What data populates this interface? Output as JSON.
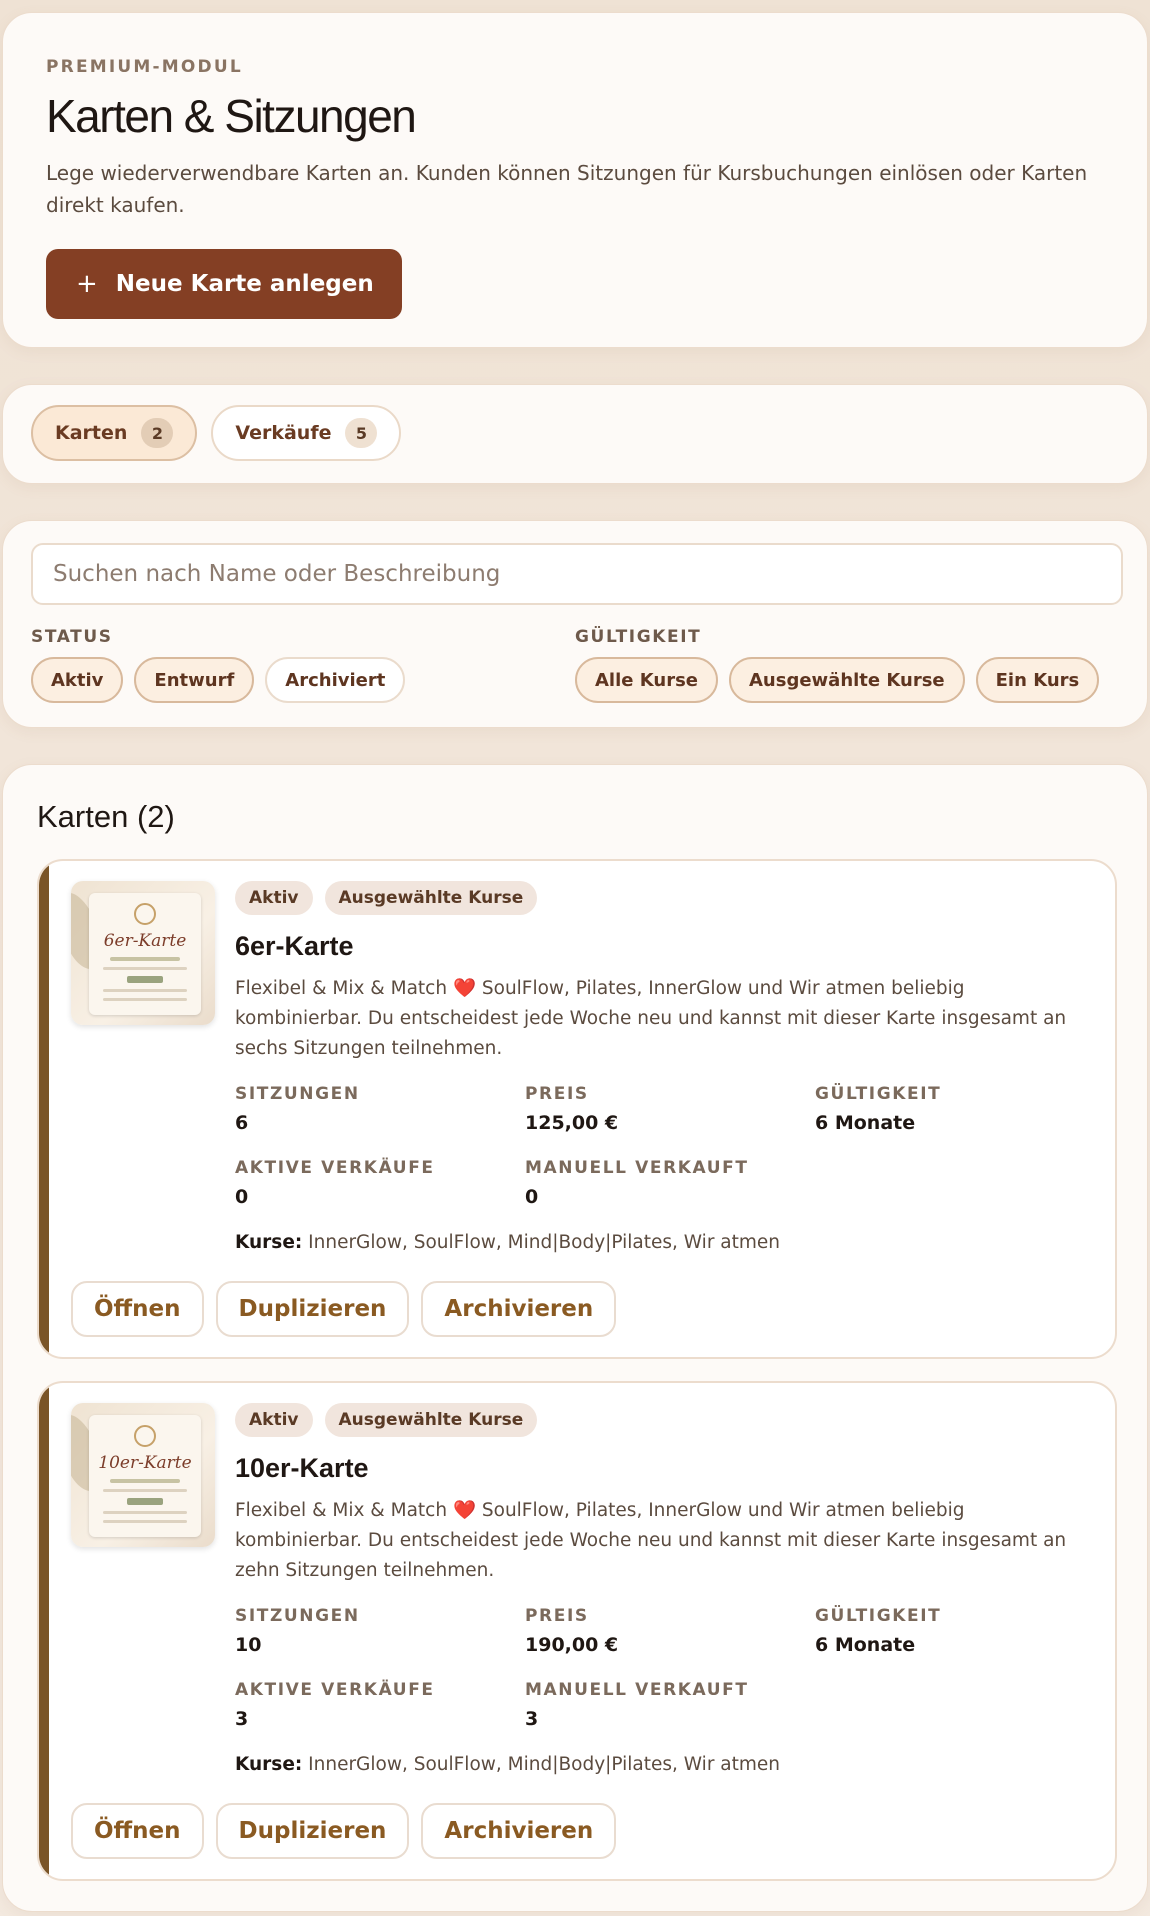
{
  "hero": {
    "eyebrow": "PREMIUM-MODUL",
    "title": "Karten & Sitzungen",
    "description": "Lege wiederverwendbare Karten an. Kunden können Sitzungen für Kursbuchungen einlösen oder Karten direkt kaufen.",
    "new_button_icon": "+",
    "new_button_label": "Neue Karte anlegen"
  },
  "tabs": [
    {
      "label": "Karten",
      "count": "2",
      "active": true
    },
    {
      "label": "Verkäufe",
      "count": "5",
      "active": false
    }
  ],
  "filters": {
    "search_placeholder": "Suchen nach Name oder Beschreibung",
    "status_label": "STATUS",
    "status_options": [
      "Aktiv",
      "Entwurf",
      "Archiviert"
    ],
    "validity_label": "GÜLTIGKEIT",
    "validity_options": [
      "Alle Kurse",
      "Ausgewählte Kurse",
      "Ein Kurs"
    ]
  },
  "list": {
    "title": "Karten (2)",
    "labels": {
      "sessions": "SITZUNGEN",
      "price": "PREIS",
      "validity": "GÜLTIGKEIT",
      "active_sales": "AKTIVE VERKÄUFE",
      "manual_sold": "MANUELL VERKAUFT",
      "courses": "Kurse:"
    },
    "actions": {
      "open": "Öffnen",
      "duplicate": "Duplizieren",
      "archive": "Archivieren"
    },
    "items": [
      {
        "thumb_text": "6er-Karte",
        "status_badge": "Aktiv",
        "scope_badge": "Ausgewählte Kurse",
        "title": "6er-Karte",
        "desc_before": "Flexibel & Mix & Match ",
        "desc_emoji": "❤️",
        "desc_after": " SoulFlow, Pilates, InnerGlow und Wir atmen beliebig kombinierbar. Du entscheidest jede Woche neu und kannst mit dieser Karte insgesamt an sechs Sitzungen teilnehmen.",
        "sessions": "6",
        "price": "125,00 €",
        "validity": "6 Monate",
        "active_sales": "0",
        "manual_sold": "0",
        "courses": "InnerGlow, SoulFlow, Mind|Body|Pilates, Wir atmen"
      },
      {
        "thumb_text": "10er-Karte",
        "status_badge": "Aktiv",
        "scope_badge": "Ausgewählte Kurse",
        "title": "10er-Karte",
        "desc_before": "Flexibel & Mix & Match ",
        "desc_emoji": "❤️",
        "desc_after": " SoulFlow, Pilates, InnerGlow und Wir atmen beliebig kombinierbar. Du entscheidest jede Woche neu und kannst mit dieser Karte insgesamt an zehn Sitzungen teilnehmen.",
        "sessions": "10",
        "price": "190,00 €",
        "validity": "6 Monate",
        "active_sales": "3",
        "manual_sold": "3",
        "courses": "InnerGlow, SoulFlow, Mind|Body|Pilates, Wir atmen"
      }
    ]
  },
  "colors": {
    "accent": "#843f24",
    "stripe": "#7a5427",
    "action_text": "#8a5a22",
    "heart": "#d63b3b"
  }
}
